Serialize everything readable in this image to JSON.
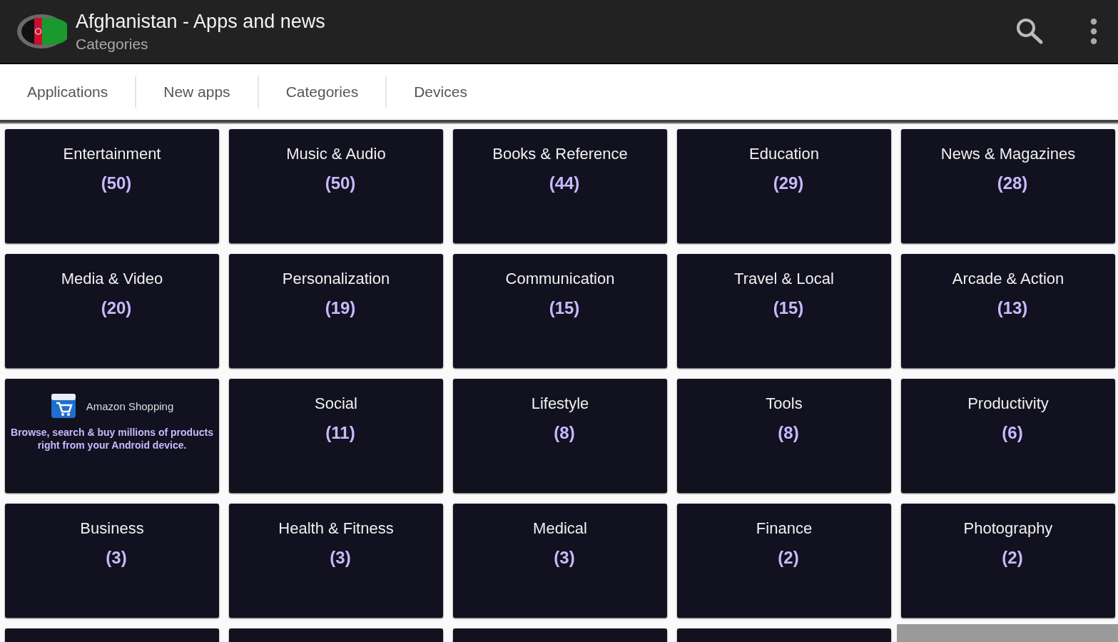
{
  "app_bar": {
    "title": "Afghanistan - Apps and news",
    "subtitle": "Categories"
  },
  "tabs": [
    {
      "label": "Applications"
    },
    {
      "label": "New apps"
    },
    {
      "label": "Categories"
    },
    {
      "label": "Devices"
    }
  ],
  "tiles": [
    {
      "kind": "category",
      "name": "Entertainment",
      "count": "(50)"
    },
    {
      "kind": "category",
      "name": "Music & Audio",
      "count": "(50)"
    },
    {
      "kind": "category",
      "name": "Books & Reference",
      "count": "(44)"
    },
    {
      "kind": "category",
      "name": "Education",
      "count": "(29)"
    },
    {
      "kind": "category",
      "name": "News & Magazines",
      "count": "(28)"
    },
    {
      "kind": "category",
      "name": "Media & Video",
      "count": "(20)"
    },
    {
      "kind": "category",
      "name": "Personalization",
      "count": "(19)"
    },
    {
      "kind": "category",
      "name": "Communication",
      "count": "(15)"
    },
    {
      "kind": "category",
      "name": "Travel & Local",
      "count": "(15)"
    },
    {
      "kind": "category",
      "name": "Arcade & Action",
      "count": "(13)"
    },
    {
      "kind": "ad",
      "name": "Amazon Shopping",
      "description": "Browse, search & buy millions of products right from your Android device."
    },
    {
      "kind": "category",
      "name": "Social",
      "count": "(11)"
    },
    {
      "kind": "category",
      "name": "Lifestyle",
      "count": "(8)"
    },
    {
      "kind": "category",
      "name": "Tools",
      "count": "(8)"
    },
    {
      "kind": "category",
      "name": "Productivity",
      "count": "(6)"
    },
    {
      "kind": "category",
      "name": "Business",
      "count": "(3)"
    },
    {
      "kind": "category",
      "name": "Health & Fitness",
      "count": "(3)"
    },
    {
      "kind": "category",
      "name": "Medical",
      "count": "(3)"
    },
    {
      "kind": "category",
      "name": "Finance",
      "count": "(2)"
    },
    {
      "kind": "category",
      "name": "Photography",
      "count": "(2)"
    },
    {
      "kind": "partial"
    },
    {
      "kind": "partial"
    },
    {
      "kind": "partial"
    },
    {
      "kind": "partial"
    },
    {
      "kind": "placeholder"
    }
  ]
}
